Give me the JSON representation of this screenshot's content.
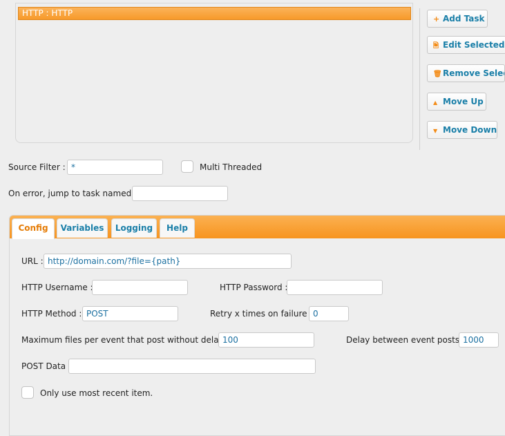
{
  "task_list": {
    "items": [
      "HTTP : HTTP"
    ]
  },
  "buttons": {
    "add_task": "Add Task",
    "edit_selected": "Edit Selected",
    "remove_selected": "Remove Selected",
    "move_up": "Move Up",
    "move_down": "Move Down"
  },
  "icons": {
    "add": "+",
    "edit": "🗎",
    "remove": "🗑",
    "up": "▲",
    "down": "▼"
  },
  "filters": {
    "source_filter_label": "Source Filter :",
    "source_filter_value": "*",
    "multi_threaded_label": "Multi Threaded",
    "on_error_label": "On error, jump to task named :",
    "on_error_value": ""
  },
  "tabs": [
    "Config",
    "Variables",
    "Logging",
    "Help"
  ],
  "config": {
    "url_label": "URL :",
    "url_value": "http://domain.com/?file={path}",
    "username_label": "HTTP Username :",
    "username_value": "",
    "password_label": "HTTP Password :",
    "password_value": "",
    "method_label": "HTTP Method :",
    "method_value": "POST",
    "retry_label": "Retry x times on failure :",
    "retry_value": "0",
    "maxfiles_label": "Maximum files per event that post without delay :",
    "maxfiles_value": "100",
    "delay_label": "Delay between event posts :",
    "delay_value": "1000",
    "postdata_label": "POST Data :",
    "postdata_value": "",
    "recent_label": "Only use most recent item."
  },
  "colors": {
    "accent_orange": "#f79a2a",
    "link_blue": "#1a7fa8",
    "active_tab_text": "#e57c06"
  }
}
